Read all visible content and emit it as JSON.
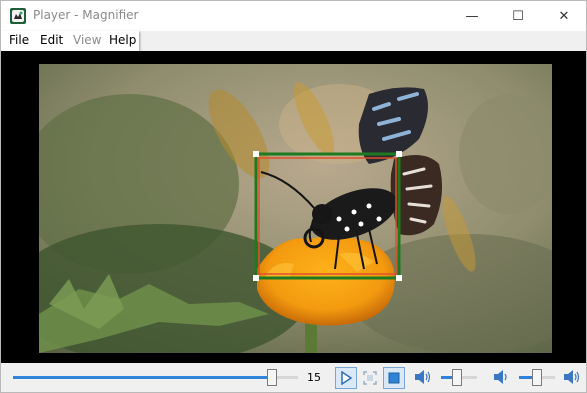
{
  "window": {
    "title": "Player - Magnifier",
    "minimize_glyph": "—",
    "maximize_glyph": "☐",
    "close_glyph": "✕"
  },
  "menu": {
    "file": "File",
    "edit": "Edit",
    "view": "View",
    "help": "Help"
  },
  "video": {
    "scene": "butterfly-on-marigold",
    "magnifier_selection": {
      "outer_color": "#1f7a1f",
      "inner_color": "#e0502a",
      "handle_color": "#ffffff"
    }
  },
  "controls": {
    "seek_fraction": 0.91,
    "time_value": "15",
    "volume_fraction": 0.45,
    "balance_fraction": 0.5,
    "accent_color": "#2f83d8",
    "icons": {
      "play": "play-icon",
      "fullscreen": "fullscreen-icon",
      "stop": "stop-icon",
      "volume": "speaker-icon",
      "volume_low": "speaker-low-icon",
      "volume_high": "speaker-high-icon"
    }
  }
}
